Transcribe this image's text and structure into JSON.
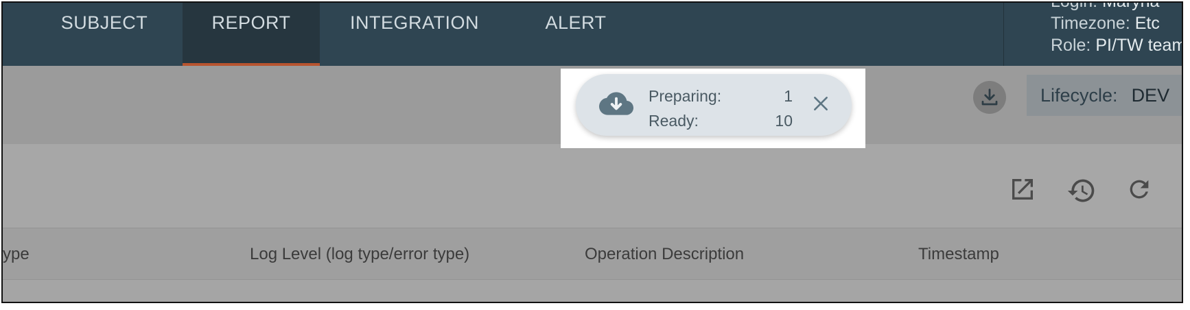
{
  "nav": {
    "tabs": [
      {
        "label": "SUBJECT",
        "active": false
      },
      {
        "label": "REPORT",
        "active": true
      },
      {
        "label": "INTEGRATION",
        "active": false
      },
      {
        "label": "ALERT",
        "active": false
      }
    ],
    "user": {
      "login_label": "Login:",
      "login_value": "Maryna",
      "timezone_label": "Timezone:",
      "timezone_value": "Etc",
      "role_label": "Role:",
      "role_value": "PI/TW team"
    }
  },
  "toolbar": {
    "download_icon": "download-icon",
    "lifecycle_label": "Lifecycle:",
    "lifecycle_value": "DEV"
  },
  "download_notification": {
    "icon": "cloud-download-icon",
    "preparing_label": "Preparing:",
    "preparing_count": "1",
    "ready_label": "Ready:",
    "ready_count": "10",
    "close_icon": "close-icon"
  },
  "panel": {
    "icons": [
      "open-external-icon",
      "history-icon",
      "refresh-icon"
    ]
  },
  "table": {
    "columns": [
      "ype",
      "Log Level (log type/error type)",
      "Operation Description",
      "Timestamp"
    ]
  },
  "colors": {
    "nav_bg": "#2f4552",
    "active_tab_bg": "#26363f",
    "active_tab_underline": "#b8542f",
    "overlay_gray": "#a3a3a3",
    "notification_bg": "#dde3e8"
  }
}
